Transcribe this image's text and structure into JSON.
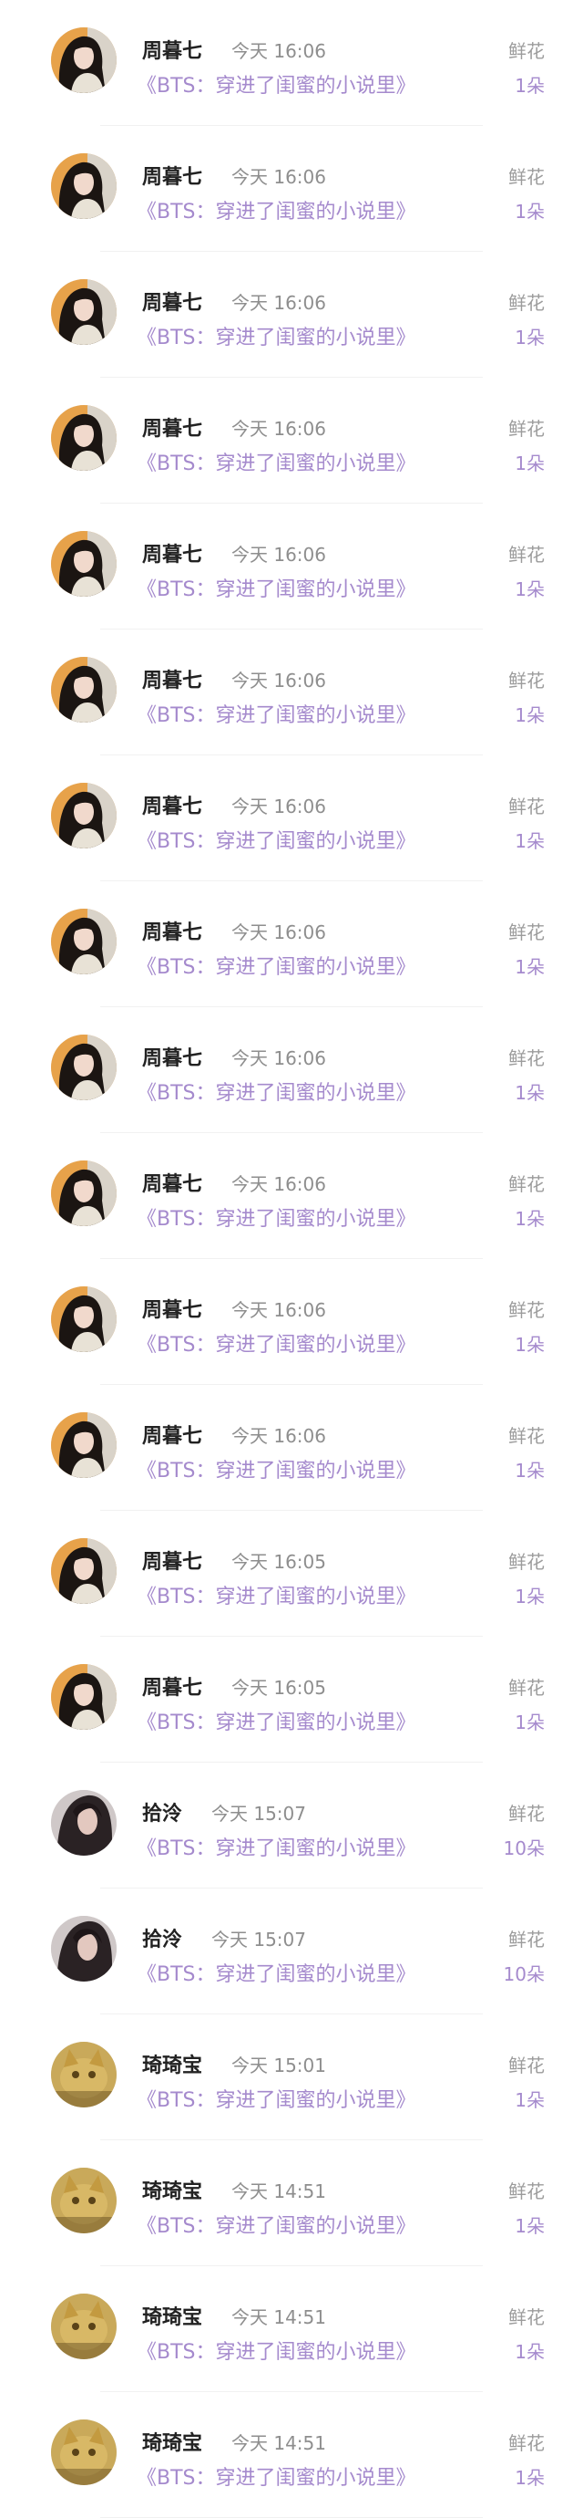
{
  "gift_list": {
    "items": [
      {
        "name": "周暮七",
        "time": "今天 16:06",
        "book": "《BTS：穿进了闺蜜的小说里》",
        "gift": "鲜花",
        "count": "1朵",
        "avatar": "avatar-girl-dark-hair-icon"
      },
      {
        "name": "周暮七",
        "time": "今天 16:06",
        "book": "《BTS：穿进了闺蜜的小说里》",
        "gift": "鲜花",
        "count": "1朵",
        "avatar": "avatar-girl-dark-hair-icon"
      },
      {
        "name": "周暮七",
        "time": "今天 16:06",
        "book": "《BTS：穿进了闺蜜的小说里》",
        "gift": "鲜花",
        "count": "1朵",
        "avatar": "avatar-girl-dark-hair-icon"
      },
      {
        "name": "周暮七",
        "time": "今天 16:06",
        "book": "《BTS：穿进了闺蜜的小说里》",
        "gift": "鲜花",
        "count": "1朵",
        "avatar": "avatar-girl-dark-hair-icon"
      },
      {
        "name": "周暮七",
        "time": "今天 16:06",
        "book": "《BTS：穿进了闺蜜的小说里》",
        "gift": "鲜花",
        "count": "1朵",
        "avatar": "avatar-girl-dark-hair-icon"
      },
      {
        "name": "周暮七",
        "time": "今天 16:06",
        "book": "《BTS：穿进了闺蜜的小说里》",
        "gift": "鲜花",
        "count": "1朵",
        "avatar": "avatar-girl-dark-hair-icon"
      },
      {
        "name": "周暮七",
        "time": "今天 16:06",
        "book": "《BTS：穿进了闺蜜的小说里》",
        "gift": "鲜花",
        "count": "1朵",
        "avatar": "avatar-girl-dark-hair-icon"
      },
      {
        "name": "周暮七",
        "time": "今天 16:06",
        "book": "《BTS：穿进了闺蜜的小说里》",
        "gift": "鲜花",
        "count": "1朵",
        "avatar": "avatar-girl-dark-hair-icon"
      },
      {
        "name": "周暮七",
        "time": "今天 16:06",
        "book": "《BTS：穿进了闺蜜的小说里》",
        "gift": "鲜花",
        "count": "1朵",
        "avatar": "avatar-girl-dark-hair-icon"
      },
      {
        "name": "周暮七",
        "time": "今天 16:06",
        "book": "《BTS：穿进了闺蜜的小说里》",
        "gift": "鲜花",
        "count": "1朵",
        "avatar": "avatar-girl-dark-hair-icon"
      },
      {
        "name": "周暮七",
        "time": "今天 16:06",
        "book": "《BTS：穿进了闺蜜的小说里》",
        "gift": "鲜花",
        "count": "1朵",
        "avatar": "avatar-girl-dark-hair-icon"
      },
      {
        "name": "周暮七",
        "time": "今天 16:06",
        "book": "《BTS：穿进了闺蜜的小说里》",
        "gift": "鲜花",
        "count": "1朵",
        "avatar": "avatar-girl-dark-hair-icon"
      },
      {
        "name": "周暮七",
        "time": "今天 16:05",
        "book": "《BTS：穿进了闺蜜的小说里》",
        "gift": "鲜花",
        "count": "1朵",
        "avatar": "avatar-girl-dark-hair-icon"
      },
      {
        "name": "周暮七",
        "time": "今天 16:05",
        "book": "《BTS：穿进了闺蜜的小说里》",
        "gift": "鲜花",
        "count": "1朵",
        "avatar": "avatar-girl-dark-hair-icon"
      },
      {
        "name": "拾泠",
        "time": "今天 15:07",
        "book": "《BTS：穿进了闺蜜的小说里》",
        "gift": "鲜花",
        "count": "10朵",
        "avatar": "avatar-long-hair-portrait-icon"
      },
      {
        "name": "拾泠",
        "time": "今天 15:07",
        "book": "《BTS：穿进了闺蜜的小说里》",
        "gift": "鲜花",
        "count": "10朵",
        "avatar": "avatar-long-hair-portrait-icon"
      },
      {
        "name": "琦琦宝",
        "time": "今天 15:01",
        "book": "《BTS：穿进了闺蜜的小说里》",
        "gift": "鲜花",
        "count": "1朵",
        "avatar": "avatar-cat-meme-icon"
      },
      {
        "name": "琦琦宝",
        "time": "今天 14:51",
        "book": "《BTS：穿进了闺蜜的小说里》",
        "gift": "鲜花",
        "count": "1朵",
        "avatar": "avatar-cat-meme-icon"
      },
      {
        "name": "琦琦宝",
        "time": "今天 14:51",
        "book": "《BTS：穿进了闺蜜的小说里》",
        "gift": "鲜花",
        "count": "1朵",
        "avatar": "avatar-cat-meme-icon"
      },
      {
        "name": "琦琦宝",
        "time": "今天 14:51",
        "book": "《BTS：穿进了闺蜜的小说里》",
        "gift": "鲜花",
        "count": "1朵",
        "avatar": "avatar-cat-meme-icon"
      }
    ]
  },
  "colors": {
    "name": "#222222",
    "time": "#8e8e8e",
    "accent_purple": "#a58acd",
    "gift_label": "#9c9c9c",
    "divider": "#f1f1f1"
  }
}
